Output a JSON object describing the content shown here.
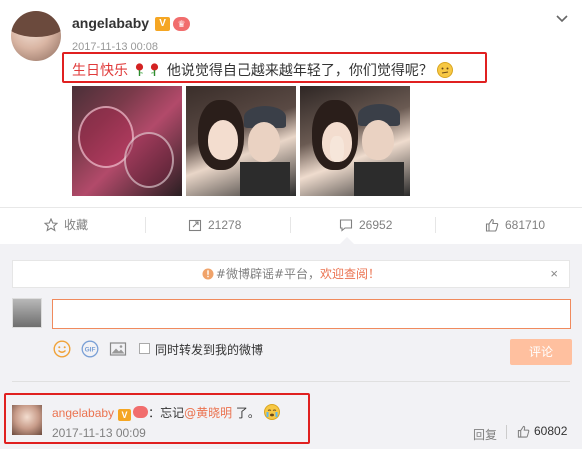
{
  "post": {
    "username": "angelababy",
    "verified_badge": "V",
    "member_badge": "♛",
    "timestamp": "2017-11-13 00:08",
    "text_highlight": "生日快乐",
    "text_body": "他说觉得自己越来越年轻了，你们觉得呢？"
  },
  "actions": {
    "favorite_label": "收藏",
    "repost_count": "21278",
    "comment_count": "26952",
    "like_count": "681710"
  },
  "comment_box": {
    "notice_tag": "#微博辟谣#平台，",
    "notice_link": "欢迎查阅！",
    "close_label": "×",
    "repost_label": "同时转发到我的微博",
    "submit_label": "评论"
  },
  "comment": {
    "username": "angelababy",
    "verified_badge": "V",
    "text_prefix": "：忘记",
    "mention": "@黄晓明",
    "text_suffix": " 了。",
    "timestamp": "2017-11-13 00:09",
    "reply_label": "回复",
    "like_count": "60802"
  },
  "colors": {
    "accent": "#eb7350",
    "highlight_box": "#e02020",
    "submit_bg": "#ffc09f",
    "verified": "#f5a623"
  }
}
